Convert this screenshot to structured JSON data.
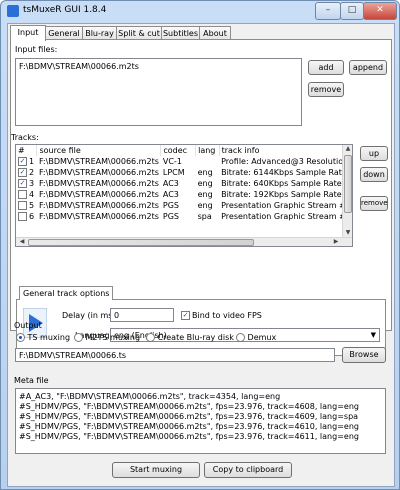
{
  "window": {
    "title": "tsMuxeR GUI 1.8.4",
    "controls": {
      "minimize": "–",
      "maximize": "□",
      "close": "✕"
    }
  },
  "tabs": [
    "Input",
    "General",
    "Blu-ray",
    "Split & cut",
    "Subtitles",
    "About"
  ],
  "input_files": {
    "label": "Input files:",
    "items": [
      "F:\\BDMV\\STREAM\\00066.m2ts"
    ],
    "add_label": "add",
    "append_label": "append",
    "remove_label": "remove"
  },
  "tracks": {
    "label": "Tracks:",
    "columns": [
      "#",
      "source file",
      "codec",
      "lang",
      "track info"
    ],
    "rows": [
      {
        "checked": true,
        "num": "1",
        "file": "F:\\BDMV\\STREAM\\00066.m2ts",
        "codec": "VC-1",
        "lang": "",
        "info": "Profile: Advanced@3 Resolutio"
      },
      {
        "checked": true,
        "num": "2",
        "file": "F:\\BDMV\\STREAM\\00066.m2ts",
        "codec": "LPCM",
        "lang": "eng",
        "info": "Bitrate: 6144Kbps  Sample Rate:"
      },
      {
        "checked": true,
        "num": "3",
        "file": "F:\\BDMV\\STREAM\\00066.m2ts",
        "codec": "AC3",
        "lang": "eng",
        "info": "Bitrate: 640Kbps  Sample Rate:"
      },
      {
        "checked": false,
        "num": "4",
        "file": "F:\\BDMV\\STREAM\\00066.m2ts",
        "codec": "AC3",
        "lang": "eng",
        "info": "Bitrate: 192Kbps  Sample Rate:"
      },
      {
        "checked": false,
        "num": "5",
        "file": "F:\\BDMV\\STREAM\\00066.m2ts",
        "codec": "PGS",
        "lang": "eng",
        "info": "Presentation Graphic Stream #"
      },
      {
        "checked": false,
        "num": "6",
        "file": "F:\\BDMV\\STREAM\\00066.m2ts",
        "codec": "PGS",
        "lang": "spa",
        "info": "Presentation Graphic Stream #"
      }
    ],
    "up_label": "up",
    "down_label": "down",
    "remove_label": "remove"
  },
  "track_options": {
    "tab_label": "General track options",
    "delay_label": "Delay (in ms):",
    "delay_value": "0",
    "bind_fps_label": "Bind to video FPS",
    "bind_fps_checked": true,
    "language_label": "Language:",
    "language_value": "eng (English)"
  },
  "output": {
    "label": "Output",
    "options": [
      "TS muxing",
      "M2TS muxing",
      "Create Blu-ray disk",
      "Demux"
    ],
    "selected": "TS muxing",
    "path": "F:\\BDMV\\STREAM\\00066.ts",
    "browse_label": "Browse"
  },
  "meta": {
    "label": "Meta file",
    "lines": [
      "#A_AC3, \"F:\\BDMV\\STREAM\\00066.m2ts\", track=4354, lang=eng",
      "#S_HDMV/PGS, \"F:\\BDMV\\STREAM\\00066.m2ts\", fps=23.976, track=4608, lang=eng",
      "#S_HDMV/PGS, \"F:\\BDMV\\STREAM\\00066.m2ts\", fps=23.976, track=4609, lang=spa",
      "#S_HDMV/PGS, \"F:\\BDMV\\STREAM\\00066.m2ts\", fps=23.976, track=4610, lang=eng",
      "#S_HDMV/PGS, \"F:\\BDMV\\STREAM\\00066.m2ts\", fps=23.976, track=4611, lang=eng"
    ]
  },
  "footer": {
    "start_label": "Start muxing",
    "copy_label": "Copy to clipboard"
  },
  "colors": {
    "title_bar": "#c9def6",
    "selection_accent": "#1a4fb0"
  },
  "icons": [
    "app-icon",
    "play-arrow-icon",
    "checkbox-icon",
    "radio-icon",
    "dropdown-arrow-icon"
  ]
}
